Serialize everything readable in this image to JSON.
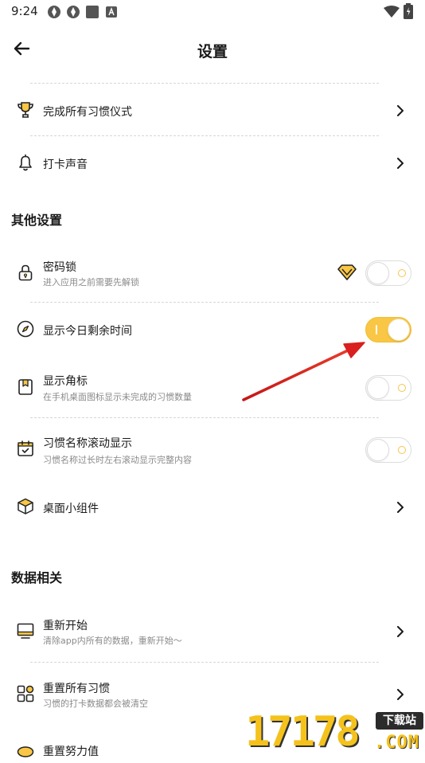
{
  "status": {
    "time": "9:24"
  },
  "header": {
    "title": "设置"
  },
  "rows": {
    "habit_ritual": {
      "title": "完成所有习惯仪式"
    },
    "checkin_sound": {
      "title": "打卡声音"
    },
    "passcode_lock": {
      "title": "密码锁",
      "subtitle": "进入应用之前需要先解锁",
      "enabled": false
    },
    "show_remaining_time": {
      "title": "显示今日剩余时间",
      "enabled": true
    },
    "show_badge": {
      "title": "显示角标",
      "subtitle": "在手机桌面图标显示未完成的习惯数量",
      "enabled": false
    },
    "habit_name_scroll": {
      "title": "习惯名称滚动显示",
      "subtitle": "习惯名称过长时左右滚动显示完整内容",
      "enabled": false
    },
    "desktop_widget": {
      "title": "桌面小组件"
    },
    "restart": {
      "title": "重新开始",
      "subtitle": "清除app内所有的数据，重新开始～"
    },
    "reset_all_habits": {
      "title": "重置所有习惯",
      "subtitle": "习惯的打卡数据都会被清空"
    },
    "reset_effort": {
      "title": "重置努力值"
    }
  },
  "sections": {
    "other": "其他设置",
    "data": "数据相关"
  },
  "watermark": {
    "digits": "17178",
    "badge": "下载站",
    "domain": ".COM"
  },
  "colors": {
    "accent": "#f9c745",
    "arrow": "#d91f1f"
  }
}
